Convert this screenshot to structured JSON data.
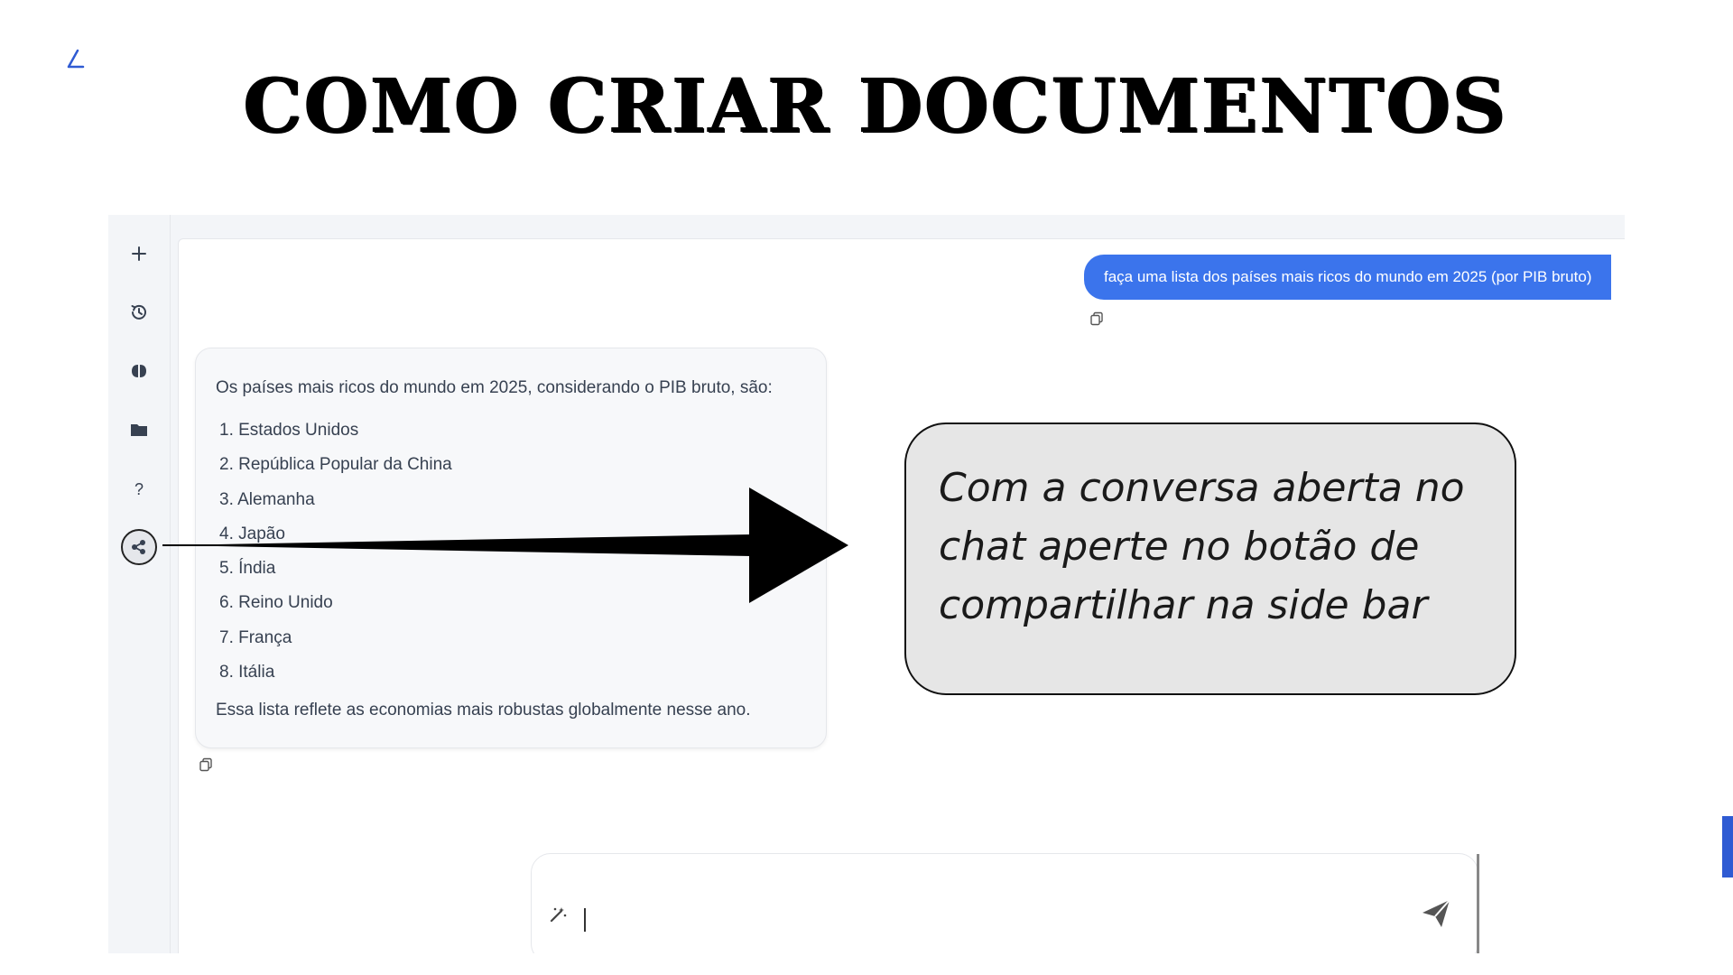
{
  "slide": {
    "title": "COMO CRIAR DOCUMENTOS"
  },
  "chat": {
    "user_message": "faça uma lista dos países mais ricos do mundo em 2025 (por PIB bruto)",
    "assistant": {
      "intro": "Os países mais ricos do mundo em 2025, considerando o PIB bruto, são:",
      "items": [
        "1. Estados Unidos",
        "2. República Popular da China",
        "3. Alemanha",
        "4. Japão",
        "5. Índia",
        "6. Reino Unido",
        "7. França",
        "8. Itália"
      ],
      "outro": "Essa lista reflete as economias mais robustas globalmente nesse ano."
    }
  },
  "sidebar": {
    "buttons": [
      {
        "icon": "plus-icon"
      },
      {
        "icon": "history-icon"
      },
      {
        "icon": "brain-icon"
      },
      {
        "icon": "folder-icon"
      },
      {
        "icon": "help-icon"
      },
      {
        "icon": "share-icon",
        "highlighted": true
      }
    ]
  },
  "composer": {
    "left_icon": "magic-wand-icon",
    "right_icon": "send-icon"
  },
  "annotation": {
    "callout_text": "Com a conversa aberta no chat aperte no botão de compartilhar na side bar"
  },
  "colors": {
    "user_bubble": "#3b74ec",
    "callout_bg": "#e6e6e6",
    "accent": "#2f5bd3"
  }
}
